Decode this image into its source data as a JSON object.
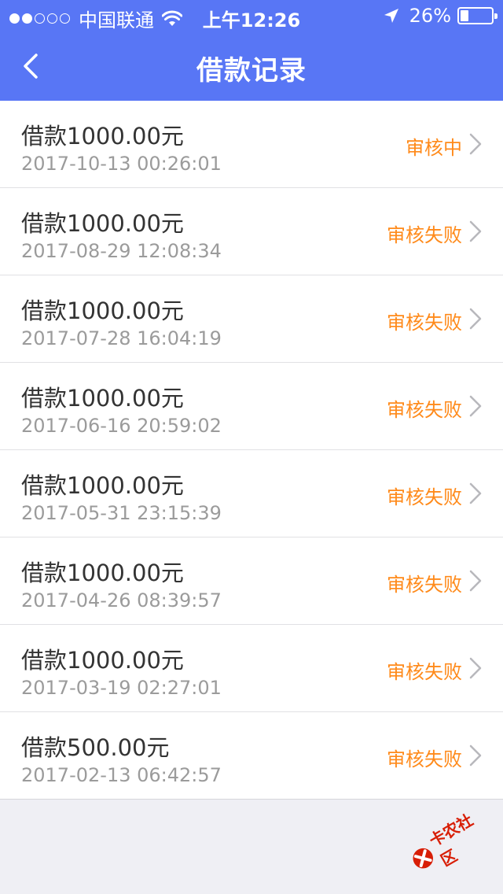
{
  "status_bar": {
    "carrier": "中国联通",
    "time": "上午12:26",
    "battery": "26%",
    "battery_level": 0.26,
    "signal_bars_filled": 2,
    "signal_bars_total": 5
  },
  "nav": {
    "title": "借款记录",
    "back_icon": "chevron-left-icon"
  },
  "records": [
    {
      "amount": "借款1000.00元",
      "time": "2017-10-13 00:26:01",
      "status": "审核中"
    },
    {
      "amount": "借款1000.00元",
      "time": "2017-08-29 12:08:34",
      "status": "审核失败"
    },
    {
      "amount": "借款1000.00元",
      "time": "2017-07-28 16:04:19",
      "status": "审核失败"
    },
    {
      "amount": "借款1000.00元",
      "time": "2017-06-16 20:59:02",
      "status": "审核失败"
    },
    {
      "amount": "借款1000.00元",
      "time": "2017-05-31 23:15:39",
      "status": "审核失败"
    },
    {
      "amount": "借款1000.00元",
      "time": "2017-04-26 08:39:57",
      "status": "审核失败"
    },
    {
      "amount": "借款1000.00元",
      "time": "2017-03-19 02:27:01",
      "status": "审核失败"
    },
    {
      "amount": "借款500.00元",
      "time": "2017-02-13 06:42:57",
      "status": "审核失败"
    }
  ],
  "watermark": {
    "text": "卡农社区"
  },
  "colors": {
    "header": "#5876f5",
    "status_text": "#ff8a1a",
    "amount_text": "#333333",
    "time_text": "#9b9b9b"
  }
}
